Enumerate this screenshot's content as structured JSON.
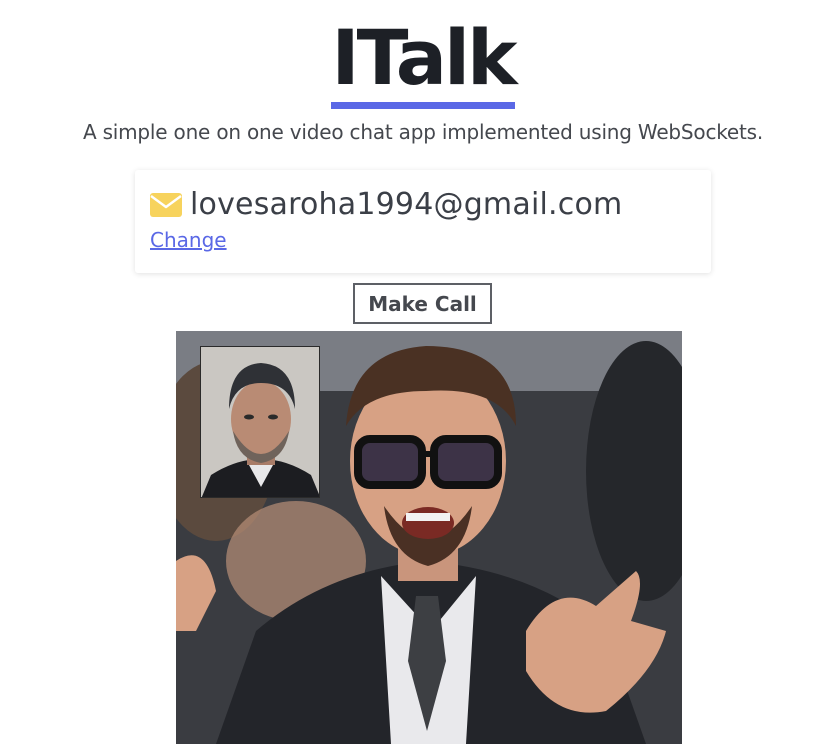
{
  "app": {
    "title": "ITalk",
    "subtitle": "A simple one on one video chat app implemented using WebSockets."
  },
  "user": {
    "email": "lovesaroha1994@gmail.com",
    "change_label": "Change",
    "mail_icon": "envelope-icon"
  },
  "actions": {
    "call_label": "Make Call"
  },
  "colors": {
    "accent": "#5a68e6",
    "mail_icon": "#f7d35d",
    "text": "#3b3f47"
  }
}
